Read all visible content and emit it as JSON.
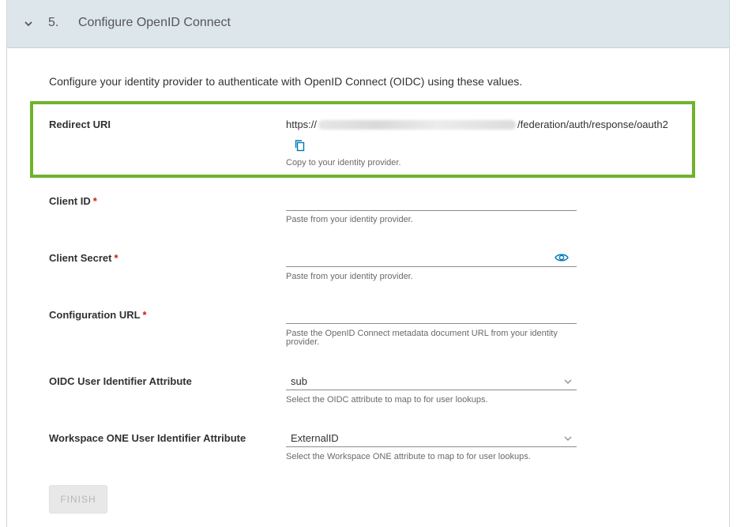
{
  "header": {
    "step_number": "5.",
    "title": "Configure OpenID Connect"
  },
  "intro": "Configure your identity provider to authenticate with OpenID Connect (OIDC) using these values.",
  "redirect": {
    "label": "Redirect URI",
    "url_prefix": "https://",
    "url_suffix": "/federation/auth/response/oauth2",
    "help": "Copy to your identity provider."
  },
  "client_id": {
    "label": "Client ID",
    "required": "*",
    "value": "",
    "help": "Paste from your identity provider."
  },
  "client_secret": {
    "label": "Client Secret",
    "required": "*",
    "value": "",
    "help": "Paste from your identity provider."
  },
  "configuration_url": {
    "label": "Configuration URL",
    "required": "*",
    "value": "",
    "help": "Paste the OpenID Connect metadata document URL from your identity provider."
  },
  "oidc_attr": {
    "label": "OIDC User Identifier Attribute",
    "selected": "sub",
    "help": "Select the OIDC attribute to map to for user lookups."
  },
  "ws1_attr": {
    "label": "Workspace ONE User Identifier Attribute",
    "selected": "ExternalID",
    "help": "Select the Workspace ONE attribute to map to for user lookups."
  },
  "actions": {
    "finish_label": "FINISH"
  },
  "colors": {
    "highlight": "#6fb32b",
    "required": "#c92100",
    "accent": "#0079b8",
    "header_bg": "#dde6eb"
  },
  "icons": {
    "collapse": "chevron-down-icon",
    "copy": "copy-icon",
    "reveal": "eye-icon",
    "select": "caret-down-icon"
  }
}
